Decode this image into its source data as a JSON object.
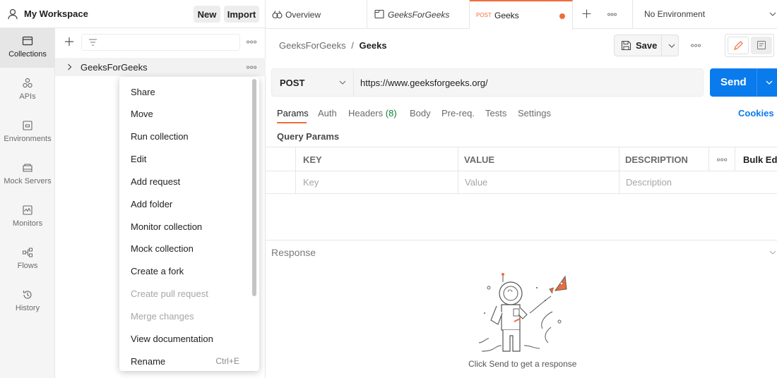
{
  "workspace": {
    "title": "My Workspace",
    "new_label": "New",
    "import_label": "Import"
  },
  "rail": [
    {
      "label": "Collections",
      "icon": "collections-icon"
    },
    {
      "label": "APIs",
      "icon": "apis-icon"
    },
    {
      "label": "Environments",
      "icon": "environments-icon"
    },
    {
      "label": "Mock Servers",
      "icon": "mock-servers-icon"
    },
    {
      "label": "Monitors",
      "icon": "monitors-icon"
    },
    {
      "label": "Flows",
      "icon": "flows-icon"
    },
    {
      "label": "History",
      "icon": "history-icon"
    }
  ],
  "collection": {
    "name": "GeeksForGeeks"
  },
  "context_menu": [
    {
      "label": "Share",
      "disabled": false
    },
    {
      "label": "Move",
      "disabled": false
    },
    {
      "label": "Run collection",
      "disabled": false
    },
    {
      "label": "Edit",
      "disabled": false
    },
    {
      "label": "Add request",
      "disabled": false
    },
    {
      "label": "Add folder",
      "disabled": false
    },
    {
      "label": "Monitor collection",
      "disabled": false
    },
    {
      "label": "Mock collection",
      "disabled": false
    },
    {
      "label": "Create a fork",
      "disabled": false
    },
    {
      "label": "Create pull request",
      "disabled": true
    },
    {
      "label": "Merge changes",
      "disabled": true
    },
    {
      "label": "View documentation",
      "disabled": false
    },
    {
      "label": "Rename",
      "shortcut": "Ctrl+E",
      "disabled": false
    }
  ],
  "tabs": {
    "overview": "Overview",
    "collection": "GeeksForGeeks",
    "request_method": "POST",
    "request_name": "Geeks",
    "environment": "No Environment"
  },
  "breadcrumb": {
    "parent": "GeeksForGeeks",
    "sep": "/",
    "current": "Geeks"
  },
  "save_label": "Save",
  "request": {
    "method": "POST",
    "url": "https://www.geeksforgeeks.org/",
    "send_label": "Send"
  },
  "req_tabs": {
    "params": "Params",
    "auth": "Auth",
    "headers": "Headers",
    "headers_count": "(8)",
    "body": "Body",
    "prereq": "Pre-req.",
    "tests": "Tests",
    "settings": "Settings",
    "cookies": "Cookies"
  },
  "query": {
    "title": "Query Params",
    "headers": {
      "key": "KEY",
      "value": "VALUE",
      "description": "DESCRIPTION",
      "bulk": "Bulk Edit"
    },
    "placeholders": {
      "key": "Key",
      "value": "Value",
      "description": "Description"
    }
  },
  "response": {
    "label": "Response",
    "hint": "Click Send to get a response"
  },
  "colors": {
    "accent": "#f26b3a",
    "send": "#097bed",
    "headers_count": "#0f7d3a"
  }
}
